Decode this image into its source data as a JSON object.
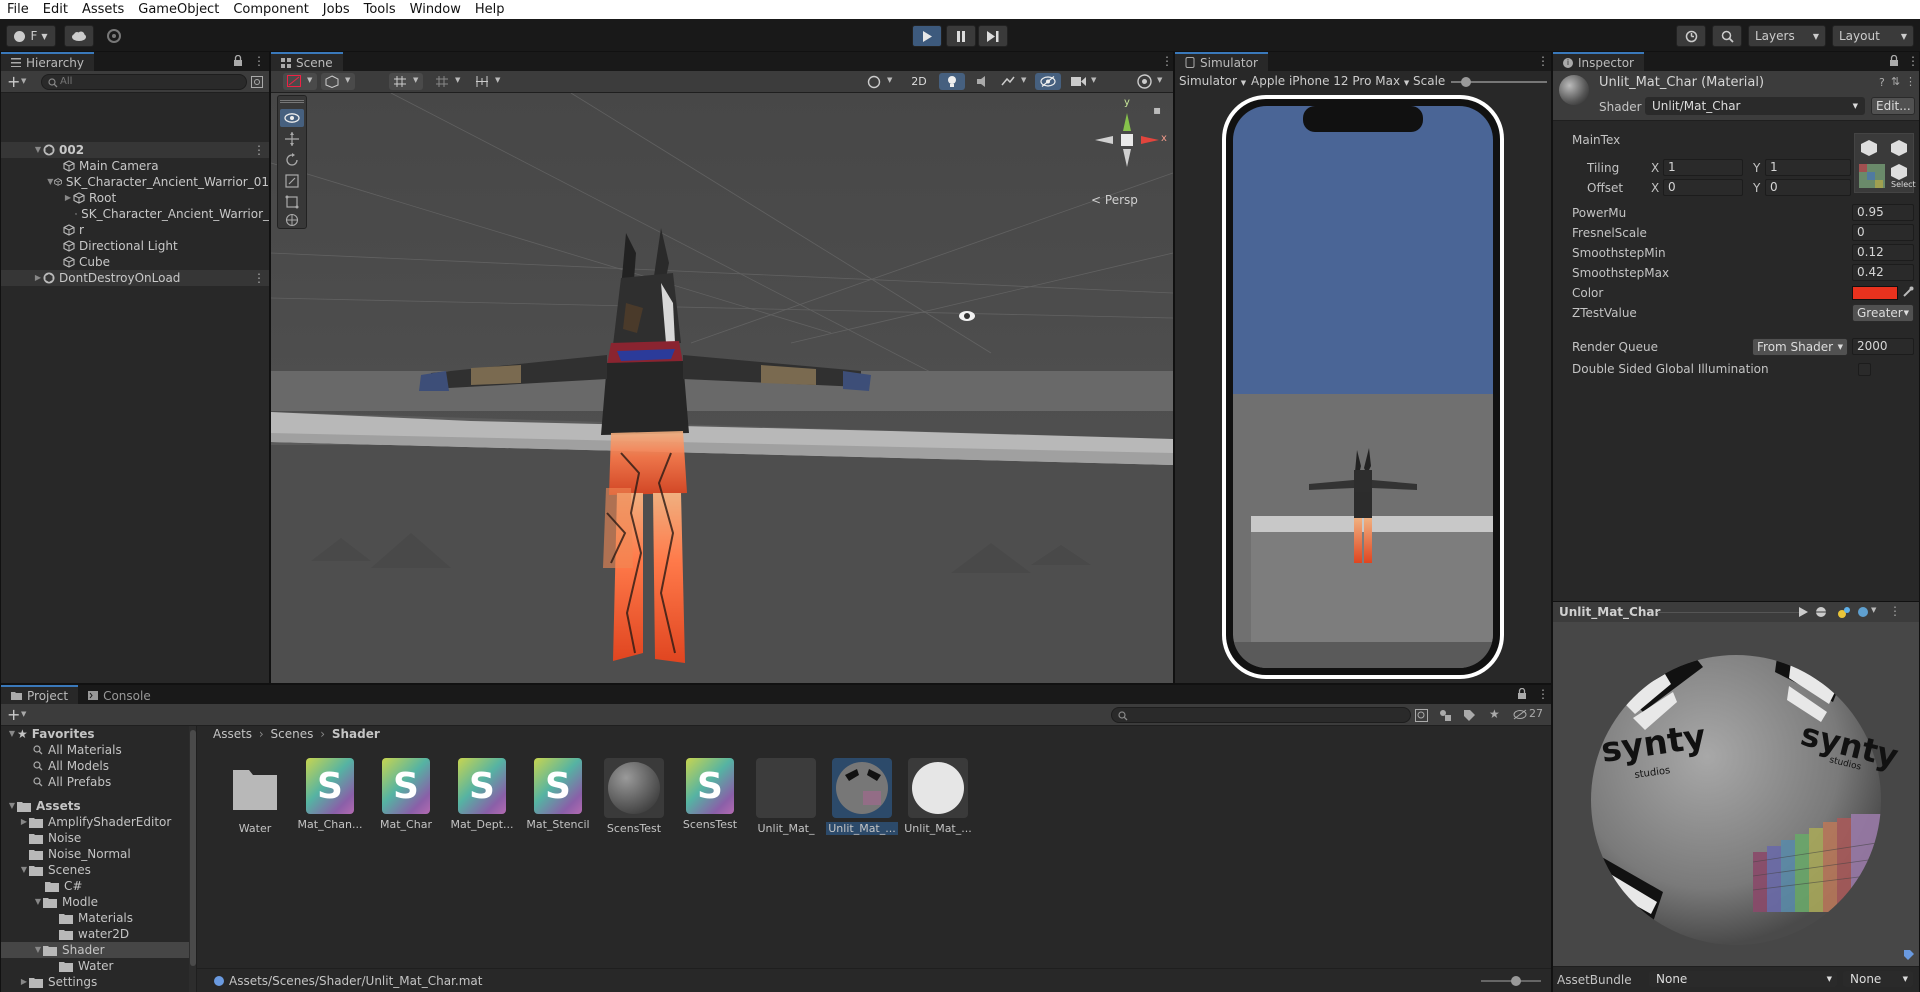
{
  "menu": [
    "File",
    "Edit",
    "Assets",
    "GameObject",
    "Component",
    "Jobs",
    "Tools",
    "Window",
    "Help"
  ],
  "toolbar": {
    "account_label": "F",
    "layers_label": "Layers",
    "layout_label": "Layout"
  },
  "hierarchy": {
    "tab": "Hierarchy",
    "search_placeholder": "All",
    "items": [
      {
        "label": "002",
        "kind": "scene"
      },
      {
        "label": "Main Camera",
        "kind": "object"
      },
      {
        "label": "SK_Character_Ancient_Warrior_01",
        "kind": "object"
      },
      {
        "label": "Root",
        "kind": "object"
      },
      {
        "label": "SK_Character_Ancient_Warrior_",
        "kind": "object"
      },
      {
        "label": "r",
        "kind": "object"
      },
      {
        "label": "Directional Light",
        "kind": "object"
      },
      {
        "label": "Cube",
        "kind": "object"
      },
      {
        "label": "DontDestroyOnLoad",
        "kind": "scene"
      }
    ]
  },
  "scene": {
    "tab": "Scene",
    "mode_2d": "2D",
    "persp_label": "Persp",
    "gizmo_y": "y",
    "gizmo_x": "x"
  },
  "simulator": {
    "tab": "Simulator",
    "mode": "Simulator",
    "device": "Apple iPhone 12 Pro Max",
    "scale_label": "Scale"
  },
  "inspector": {
    "tab": "Inspector",
    "material_name": "Unlit_Mat_Char (Material)",
    "shader_label": "Shader",
    "shader_value": "Unlit/Mat_Char",
    "edit_button": "Edit...",
    "maintex_label": "MainTex",
    "tiling_label": "Tiling",
    "offset_label": "Offset",
    "x_label": "X",
    "y_label": "Y",
    "tiling_x": "1",
    "tiling_y": "1",
    "offset_x": "0",
    "offset_y": "0",
    "select_label": "Select",
    "props": [
      {
        "name": "PowerMu",
        "value": "0.95"
      },
      {
        "name": "FresnelScale",
        "value": "0"
      },
      {
        "name": "SmoothstepMin",
        "value": "0.12"
      },
      {
        "name": "SmoothstepMax",
        "value": "0.42"
      }
    ],
    "color_label": "Color",
    "color_value": "#e8321e",
    "ztest_label": "ZTestValue",
    "ztest_value": "Greater",
    "render_queue_label": "Render Queue",
    "render_queue_mode": "From Shader",
    "render_queue_value": "2000",
    "dsgi_label": "Double Sided Global Illumination"
  },
  "preview": {
    "title": "Unlit_Mat_Char",
    "logo_text": "synty",
    "logo_sub": "studios",
    "assetbundle_label": "AssetBundle",
    "assetbundle_value": "None",
    "variant_value": "None"
  },
  "project": {
    "tab_project": "Project",
    "tab_console": "Console",
    "hidden_count": "27",
    "breadcrumb": [
      "Assets",
      "Scenes",
      "Shader"
    ],
    "favorites_label": "Favorites",
    "favorites": [
      "All Materials",
      "All Models",
      "All Prefabs"
    ],
    "assets_label": "Assets",
    "tree": [
      {
        "label": "AmplifyShaderEditor",
        "depth": 1
      },
      {
        "label": "Noise",
        "depth": 1
      },
      {
        "label": "Noise_Normal",
        "depth": 1
      },
      {
        "label": "Scenes",
        "depth": 1
      },
      {
        "label": "C#",
        "depth": 2
      },
      {
        "label": "Modle",
        "depth": 2
      },
      {
        "label": "Materials",
        "depth": 3
      },
      {
        "label": "water2D",
        "depth": 3
      },
      {
        "label": "Shader",
        "depth": 2
      },
      {
        "label": "Water",
        "depth": 3
      },
      {
        "label": "Settings",
        "depth": 1
      }
    ],
    "grid": [
      {
        "label": "Water",
        "kind": "folder"
      },
      {
        "label": "Mat_Chan...",
        "kind": "shader"
      },
      {
        "label": "Mat_Char",
        "kind": "shader"
      },
      {
        "label": "Mat_Dept...",
        "kind": "shader"
      },
      {
        "label": "Mat_Stencil",
        "kind": "shader"
      },
      {
        "label": "ScensTest",
        "kind": "sphere"
      },
      {
        "label": "ScensTest",
        "kind": "shader"
      },
      {
        "label": "Unlit_Mat_",
        "kind": "dark"
      },
      {
        "label": "Unlit_Mat_...",
        "kind": "texsphere"
      },
      {
        "label": "Unlit_Mat_...",
        "kind": "white"
      }
    ],
    "status_path": "Assets/Scenes/Shader/Unlit_Mat_Char.mat"
  }
}
